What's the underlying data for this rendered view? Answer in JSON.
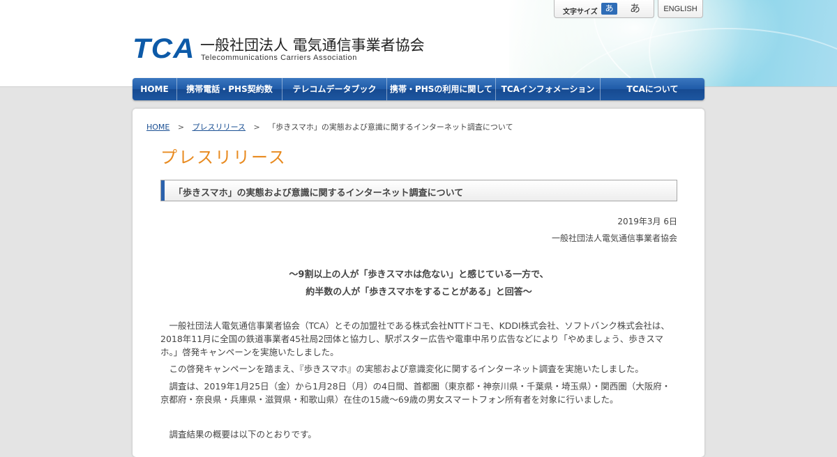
{
  "header": {
    "logo_mark": "TCA",
    "org_name_jp": "一般社団法人 電気通信事業者協会",
    "org_name_en": "Telecommunications Carriers Association",
    "font_size": {
      "label": "文字サイズ",
      "small_label": "あ",
      "large_label": "あ"
    },
    "english_label": "ENGLISH"
  },
  "nav": {
    "items": [
      {
        "label": "HOME"
      },
      {
        "label": "携帯電話・PHS契約数"
      },
      {
        "label": "テレコムデータブック"
      },
      {
        "label": "携帯・PHSの利用に関して"
      },
      {
        "label": "TCAインフォメーション"
      },
      {
        "label": "TCAについて"
      }
    ]
  },
  "breadcrumb": {
    "home": "HOME",
    "section": "プレスリリース",
    "current": "「歩きスマホ」の実態および意識に関するインターネット調査について"
  },
  "page": {
    "title": "プレスリリース",
    "article_heading": "「歩きスマホ」の実態および意識に関するインターネット調査について",
    "date": "2019年3月 6日",
    "publisher": "一般社団法人電気通信事業者協会",
    "lead_line1": "～9割以上の人が「歩きスマホは危ない」と感じている一方で、",
    "lead_line2": "約半数の人が「歩きスマホをすることがある」と回答～",
    "paragraph1": "一般社団法人電気通信事業者協会（TCA）とその加盟社である株式会社NTTドコモ、KDDI株式会社、ソフトバンク株式会社は、2018年11月に全国の鉄道事業者45社局2団体と協力し、駅ポスター広告や電車中吊り広告などにより「やめましょう、歩きスマホ。」啓発キャンペーンを実施いたしました。",
    "paragraph2": "この啓発キャンペーンを踏まえ、『歩きスマホ』の実態および意識変化に関するインターネット調査を実施いたしました。",
    "paragraph3": "調査は、2019年1月25日（金）から1月28日（月）の4日間、首都圏（東京都・神奈川県・千葉県・埼玉県）・関西圏（大阪府・京都府・奈良県・兵庫県・滋賀県・和歌山県）在住の15歳～69歳の男女スマートフォン所有者を対象に行いました。",
    "paragraph4": "調査結果の概要は以下のとおりです。"
  }
}
